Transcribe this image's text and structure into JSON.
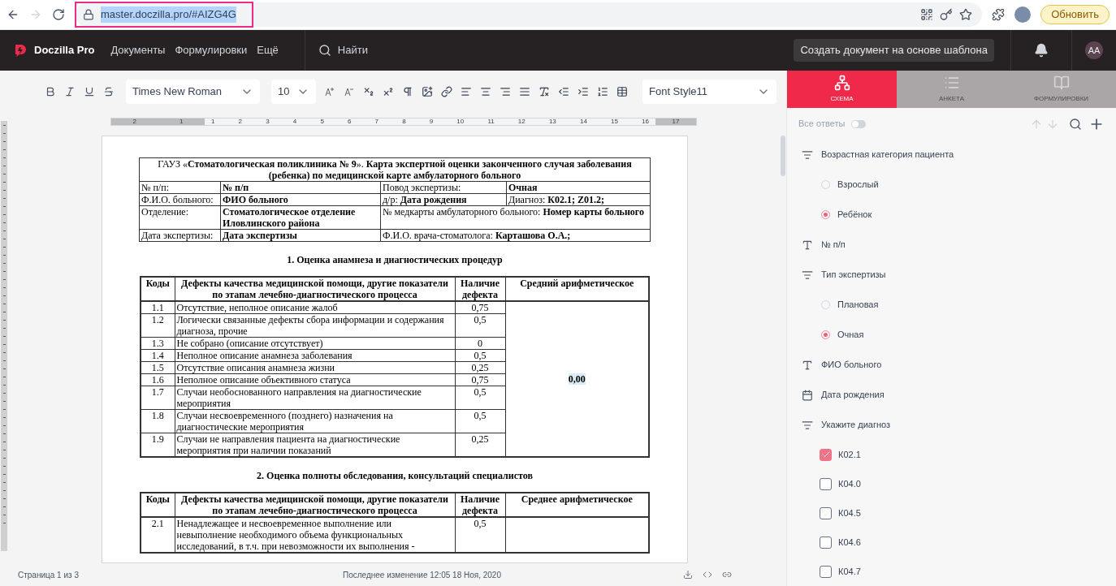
{
  "browser": {
    "url": "master.doczilla.pro/#AIZG4G",
    "update_button": "Обновить"
  },
  "header": {
    "brand": "Doczilla Pro",
    "nav": [
      "Документы",
      "Формулировки",
      "Ещё"
    ],
    "search": "Найти",
    "create_button": "Создать документ на основе шаблона",
    "avatar": "AA"
  },
  "toolbar": {
    "font": "Times New Roman",
    "size": "10",
    "style": "Font Style11"
  },
  "ruler": {
    "left_numbers": [
      "2",
      "1"
    ],
    "numbers": [
      "1",
      "2",
      "3",
      "4",
      "5",
      "6",
      "7",
      "8",
      "9",
      "10",
      "11",
      "12",
      "13",
      "14",
      "15",
      "16",
      "17"
    ]
  },
  "document": {
    "header_table": {
      "title": "ГАУЗ «**Стоматологическая поликлиника № 9**». **Карта экспертной оценки законченного случая заболевания (ребенка) по медицинской карте амбулаторного больного**",
      "rows": [
        [
          {
            "text": "№ п/п:"
          },
          {
            "text": "**№ п/п**"
          },
          {
            "text": "Повод экспертизы:"
          },
          {
            "text": "**Очная**"
          }
        ],
        [
          {
            "text": "Ф.И.О. больного:"
          },
          {
            "text": "**ФИО больного**"
          },
          {
            "text": "д/р: **Дата рождения**"
          },
          {
            "text": "Диагноз: **К02.1; Z01.2;**"
          }
        ],
        [
          {
            "text": "Отделение:"
          },
          {
            "text": "**Стоматологическое отделение Иловлинского района**"
          },
          {
            "text": "№ медкарты амбулаторного больного: **Номер карты больного**"
          }
        ],
        [
          {
            "text": "Дата экспертизы:"
          },
          {
            "text": "**Дата экспертизы**"
          },
          {
            "text": "Ф.И.О. врача-стоматолога: **Карташова О.А.;**"
          }
        ]
      ]
    },
    "sections": [
      {
        "title": "1. Оценка анамнеза и диагностических процедур",
        "columns": [
          "Коды",
          "Дефекты качества медицинской помощи, другие показатели по этапам лечебно-диагностического процесса",
          "Наличие дефекта",
          "Средний арифметическое"
        ],
        "average": "0,00",
        "rows": [
          {
            "code": "1.1",
            "text": "Отсутствие, неполное описание жалоб",
            "value": "0,75"
          },
          {
            "code": "1.2",
            "text": "Логически связанные дефекты сбора информации и содержания диагноза, прочие",
            "value": "0,5"
          },
          {
            "code": "1.3",
            "text": "Не собрано (описание отсутствует)",
            "value": "0"
          },
          {
            "code": "1.4",
            "text": "Неполное описание анамнеза заболевания",
            "value": "0,5"
          },
          {
            "code": "1.5",
            "text": "Отсутствие описания анамнеза жизни",
            "value": "0,25"
          },
          {
            "code": "1.6",
            "text": "Неполное описание объективного статуса",
            "value": "0,75"
          },
          {
            "code": "1.7",
            "text": "Случаи необоснованного направления на диагностические мероприятия",
            "value": "0,5"
          },
          {
            "code": "1.8",
            "text": "Случаи несвоевременного (позднего) назначения на диагностические мероприятия",
            "value": "0,5"
          },
          {
            "code": "1.9",
            "text": "Случаи не направления пациента на диагностические мероприятия при наличии показаний",
            "value": "0,25"
          }
        ]
      },
      {
        "title": "2. Оценка полноты обследования, консультаций специалистов",
        "columns": [
          "Коды",
          "Дефекты качества медицинской помощи, другие показатели по этапам лечебно-диагностического процесса",
          "Наличие дефекта",
          "Среднее арифметическое"
        ],
        "rows": [
          {
            "code": "2.1",
            "text": "Ненадлежащее и несвоевременное выполнение или невыполнение необходимого объема функциональных исследований, в т.ч. при невозможности их выполнения -",
            "value": "0,5"
          }
        ]
      }
    ]
  },
  "status_bar": {
    "page": "Страница 1 из 3",
    "modified": "Последнее изменение 12:05 18 Ноя, 2020"
  },
  "panel": {
    "tabs": [
      {
        "label": "СХЕМА",
        "selected": true
      },
      {
        "label": "АНКЕТА",
        "selected": false
      },
      {
        "label": "ФОРМУЛИРОВКИ",
        "selected": false
      }
    ],
    "all_answers": {
      "label": "Все ответы",
      "on": false
    },
    "items": [
      {
        "kind": "choice",
        "label": "Возрастная категория пациента"
      },
      {
        "kind": "radio",
        "label": "Взрослый",
        "selected": false
      },
      {
        "kind": "radio",
        "label": "Ребёнок",
        "selected": true
      },
      {
        "kind": "text",
        "label": "№ п/п"
      },
      {
        "kind": "choice",
        "label": "Тип экспертизы"
      },
      {
        "kind": "radio",
        "label": "Плановая",
        "selected": false
      },
      {
        "kind": "radio",
        "label": "Очная",
        "selected": true
      },
      {
        "kind": "text",
        "label": "ФИО больного"
      },
      {
        "kind": "date",
        "label": "Дата рождения"
      },
      {
        "kind": "choice",
        "label": "Укажите диагноз"
      },
      {
        "kind": "check",
        "label": "К02.1",
        "checked": true
      },
      {
        "kind": "check",
        "label": "К04.0",
        "checked": false
      },
      {
        "kind": "check",
        "label": "К04.5",
        "checked": false
      },
      {
        "kind": "check",
        "label": "К04.6",
        "checked": false
      },
      {
        "kind": "check",
        "label": "К04.7",
        "checked": false
      }
    ]
  }
}
